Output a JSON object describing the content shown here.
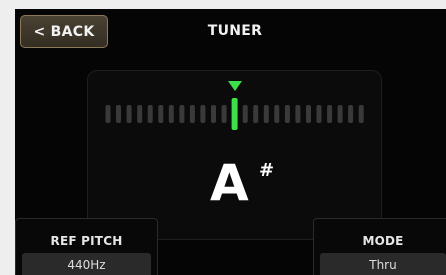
{
  "header": {
    "back_label": "< BACK",
    "title": "TUNER"
  },
  "tuner": {
    "note": "A",
    "accidental": "#",
    "colors": {
      "active_indicator": "#3ee04a",
      "inactive_segment": "#3a3a3a"
    }
  },
  "controls": {
    "ref_pitch": {
      "label": "REF PITCH",
      "value": "440Hz"
    },
    "mode": {
      "label": "MODE",
      "value": "Thru"
    }
  }
}
